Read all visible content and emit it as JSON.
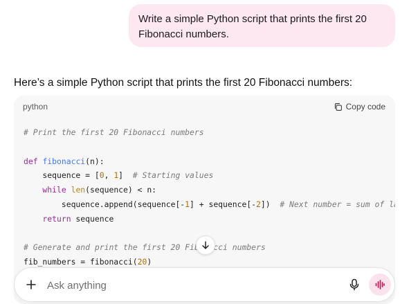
{
  "user_message": {
    "line1": "Write a simple Python script that prints the first 20",
    "line2": "Fibonacci numbers."
  },
  "assistant_intro": "Here’s a simple Python script that prints the first 20 Fibonacci numbers:",
  "code_block": {
    "language": "python",
    "copy_label": "Copy code",
    "tokens": {
      "comment1": "# Print the first 20 Fibonacci numbers",
      "kw_def": "def",
      "fn_name": "fibonacci",
      "sig_rest": "(n):",
      "seq_assign": "    sequence = [",
      "num0": "0",
      "comma": ", ",
      "num1": "1",
      "bracket_close": "]  ",
      "comment_start": "# Starting values",
      "kw_while": "    while",
      "space": " ",
      "bi_len": "len",
      "while_rest": "(sequence) < n:",
      "append_a": "        sequence.append(sequence[-",
      "neg1": "1",
      "append_b": "] + sequence[-",
      "neg2": "2",
      "append_c": "])  ",
      "comment_next": "# Next number = sum of last two",
      "kw_return": "    return",
      "return_rest": " sequence",
      "comment_gen": "# Generate and print the first 20 Fibonacci numbers",
      "fib_assign": "fib_numbers = fibonacci(",
      "num20": "20",
      "paren_close": ")"
    }
  },
  "composer": {
    "placeholder": "Ask anything"
  },
  "icons": {
    "copy": "copy-icon",
    "scroll_down": "arrow-down-icon",
    "plus": "plus-icon",
    "mic": "microphone-icon",
    "voice": "voice-wave-icon"
  },
  "colors": {
    "user_bubble": "#fde7f1",
    "code_bg": "#f7f7f7",
    "voice_button": "#fbe3ee",
    "voice_accent": "#c2185b"
  }
}
